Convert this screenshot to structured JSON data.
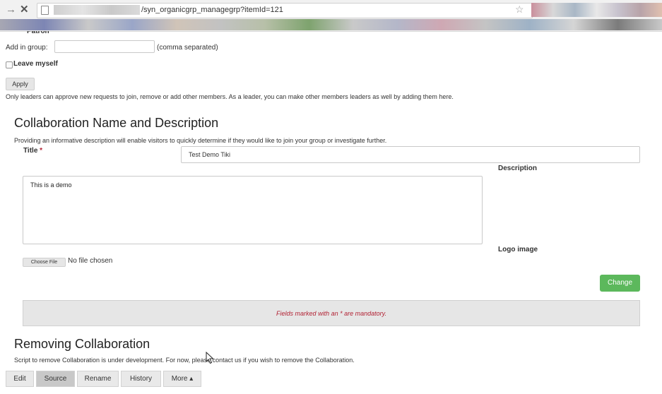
{
  "browser": {
    "back_glyph": "→",
    "stop_glyph": "✕",
    "url": "/syn_organicgrp_managegrp?itemId=121"
  },
  "membership": {
    "cut_label": "Patron",
    "add_in_group_label": "Add in group:",
    "add_in_group_value": "",
    "comma_hint": "(comma separated)",
    "leave_myself_label": "Leave myself",
    "apply_label": "Apply",
    "note": "Only leaders can approve new requests to join, remove or add other members. As a leader, you can make other members leaders as well by adding them here."
  },
  "collab": {
    "heading": "Collaboration Name and Description",
    "intro": "Providing an informative description will enable visitors to quickly determine if they would like to join your group or investigate further.",
    "title_label": "Title",
    "required_mark": "*",
    "title_value": "Test Demo Tiki",
    "description_label": "Description",
    "description_value": "This is a demo",
    "logo_label": "Logo image",
    "choose_file_label": "Choose File",
    "no_file_text": "No file chosen",
    "change_label": "Change",
    "mandatory_note": "Fields marked with an * are mandatory."
  },
  "removing": {
    "heading": "Removing Collaboration",
    "note": "Script to remove Collaboration is under development. For now, please contact us if you wish to remove the Collaboration."
  },
  "bottom_bar": {
    "edit": "Edit",
    "source": "Source",
    "rename": "Rename",
    "history": "History",
    "more": "More ▴"
  },
  "colors": {
    "accent_green": "#5cb85c",
    "required_red": "#b22234"
  }
}
